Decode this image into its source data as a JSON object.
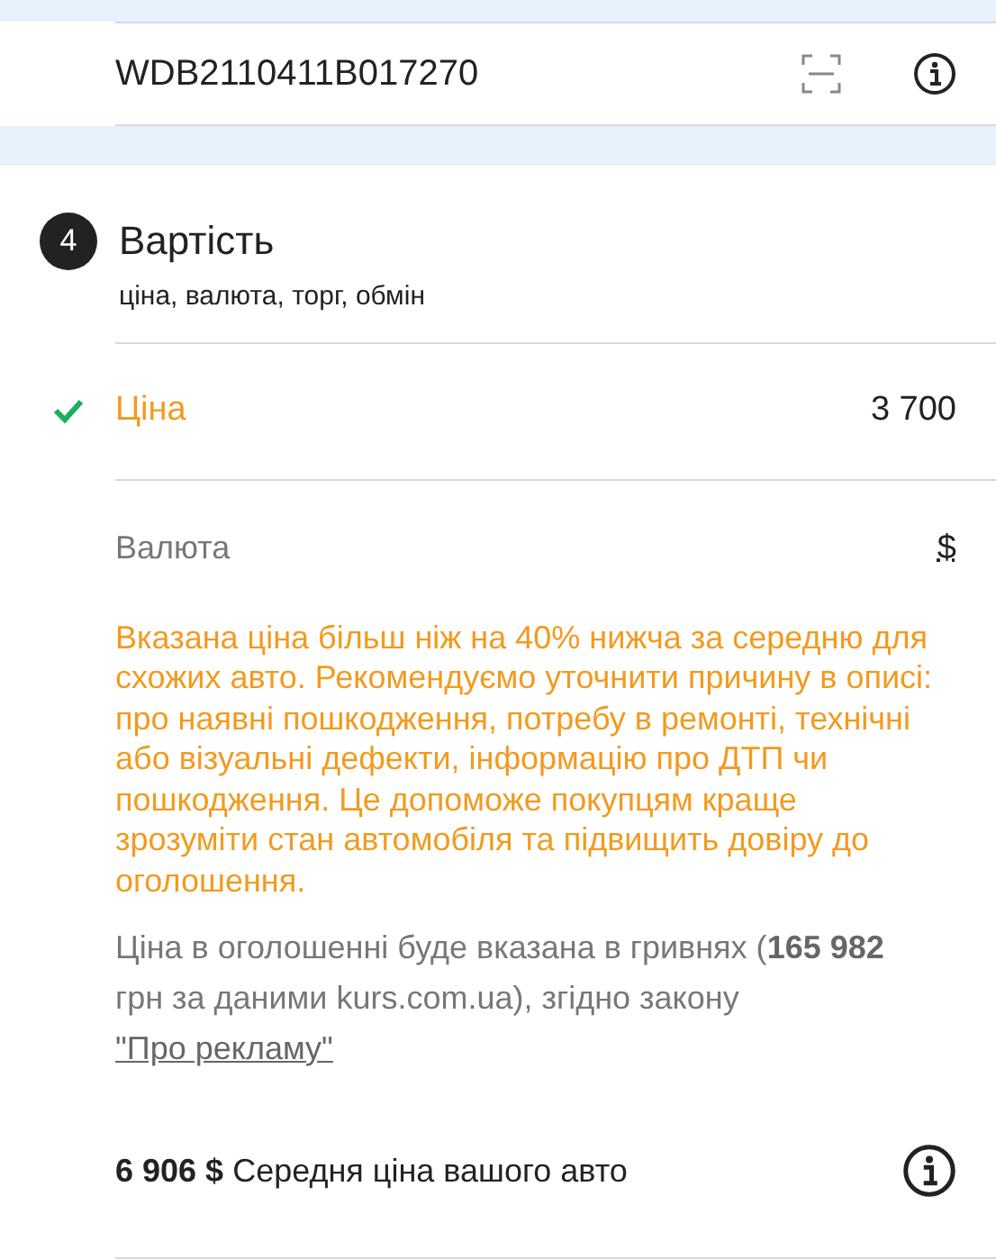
{
  "vin_row": {
    "value": "WDB2110411B017270"
  },
  "section": {
    "number": "4",
    "title": "Вартість",
    "subtitle": "ціна, валюта, торг, обмін"
  },
  "price": {
    "label": "Ціна",
    "value": "3 700",
    "checked": true
  },
  "currency": {
    "label": "Валюта",
    "value": "$"
  },
  "warning": "Вказана ціна більш ніж на 40% нижча за середню для схожих авто. Рекомендуємо уточнити причину в описі: про наявні пошкодження, потребу в ремонті, технічні або візуальні дефекти, інформацію про ДТП чи пошкодження. Це допоможе покупцям краще зрозуміти стан автомобіля та підвищить довіру до оголошення.",
  "note": {
    "text": "Ціна в оголошенні буде вказана в гривнях (**165 982** грн за даними kurs.com.ua), згідно закону",
    "link": "\"Про рекламу\""
  },
  "average": {
    "amount": "6 906 $",
    "label": "Середня ціна вашого авто"
  }
}
